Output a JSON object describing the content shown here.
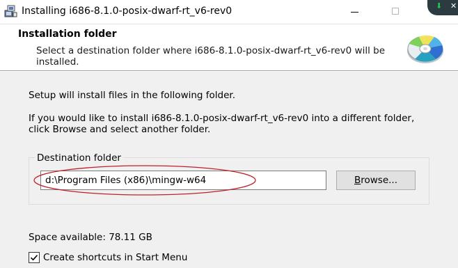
{
  "window": {
    "title": "Installing i686-8.1.0-posix-dwarf-rt_v6-rev0",
    "icon": "installer-icon"
  },
  "header": {
    "title": "Installation folder",
    "description": "Select a destination folder where i686-8.1.0-posix-dwarf-rt_v6-rev0 will be installed.",
    "icon": "cd-disc-icon"
  },
  "body": {
    "intro": "Setup will install files in the following folder.",
    "instructions": "If you would like to install i686-8.1.0-posix-dwarf-rt_v6-rev0 into a different folder, click Browse and select another folder."
  },
  "destination": {
    "group_label": "Destination folder",
    "path_value": "d:\\Program Files (x86)\\mingw-w64",
    "browse_label_mnemonic": "B",
    "browse_label_rest": "rowse...",
    "annotation_color": "#c0202a"
  },
  "space_available": "Space available: 78.11 GB",
  "shortcuts": {
    "label": "Create shortcuts in Start Menu",
    "checked": true
  },
  "colors": {
    "header_bg": "#ffffff",
    "dialog_bg": "#f0f0f0",
    "tray_badge": "#2b3b3f",
    "tray_download": "#27c24c"
  }
}
